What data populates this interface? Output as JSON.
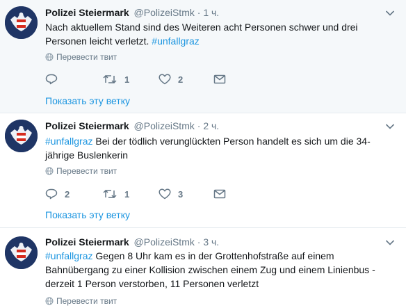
{
  "tweets": [
    {
      "author_name": "Polizei Steiermark",
      "author_handle": "@PolizeiStmk",
      "separator": "·",
      "time": "1 ч.",
      "text_parts": [
        "Nach aktuellem Stand sind des Weiteren acht Personen schwer und drei Personen leicht verletzt. ",
        "#unfallgraz"
      ],
      "translate_label": "Перевести твит",
      "reply_count": "",
      "retweet_count": "1",
      "like_count": "2",
      "thread_link": "Показать эту ветку"
    },
    {
      "author_name": "Polizei Steiermark",
      "author_handle": "@PolizeiStmk",
      "separator": "·",
      "time": "2 ч.",
      "text_parts": [
        "#unfallgraz",
        " Bei der tödlich verunglückten Person handelt es sich um die 34-jährige Buslenkerin"
      ],
      "translate_label": "Перевести твит",
      "reply_count": "2",
      "retweet_count": "1",
      "like_count": "3",
      "thread_link": "Показать эту ветку"
    },
    {
      "author_name": "Polizei Steiermark",
      "author_handle": "@PolizeiStmk",
      "separator": "·",
      "time": "3 ч.",
      "text_parts": [
        "#unfallgraz",
        " Gegen 8 Uhr kam es in der Grottenhofstraße auf einem Bahnübergang zu einer Kollision zwischen einem Zug und einem Linienbus - derzeit 1 Person verstorben, 11 Personen verletzt"
      ],
      "translate_label": "Перевести твит"
    }
  ],
  "icons": {
    "avatar": "austrian-eagle-emblem",
    "caret": "chevron-down-icon",
    "translate": "globe-icon",
    "reply": "reply-icon",
    "retweet": "retweet-icon",
    "like": "heart-icon",
    "dm": "envelope-icon"
  },
  "colors": {
    "accent": "#1b95e0",
    "secondary_text": "#657786",
    "highlight_background": "#f5f8fa",
    "avatar_background": "#1f3565",
    "emblem_red": "#d52b1e"
  }
}
